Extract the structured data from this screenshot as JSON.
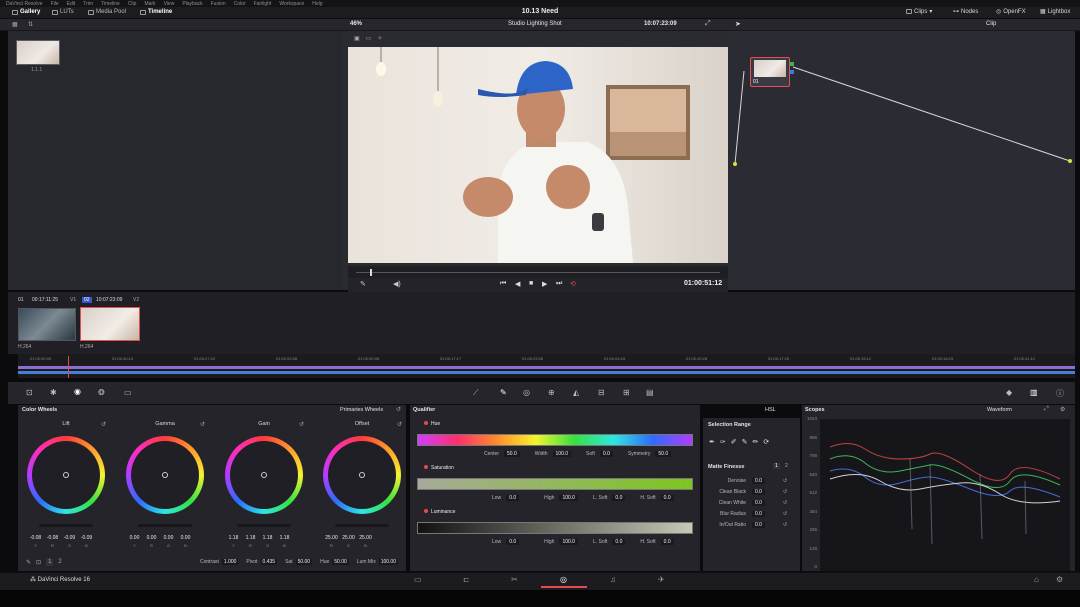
{
  "menubar": [
    "DaVinci Resolve",
    "File",
    "Edit",
    "Trim",
    "Timeline",
    "Clip",
    "Mark",
    "View",
    "Playback",
    "Fusion",
    "Color",
    "Fairlight",
    "Workspace",
    "Help"
  ],
  "topbar": {
    "tabs": [
      {
        "label": "Gallery"
      },
      {
        "label": "LUTs"
      },
      {
        "label": "Media Pool"
      },
      {
        "label": "Timeline"
      }
    ],
    "project_title": "10.13 Need",
    "right_tabs": [
      {
        "label": "Clips"
      },
      {
        "label": "Nodes"
      },
      {
        "label": "OpenFX"
      },
      {
        "label": "Lightbox"
      }
    ]
  },
  "viewer": {
    "zoom": "46%",
    "clip_name": "Studio Lighting Shot",
    "top_timecode": "10:07:23:09",
    "timecode": "01:00:51:12",
    "mode": "Clip"
  },
  "gallery": {
    "still_label": "1.1.1"
  },
  "node": {
    "label": "01"
  },
  "clips": {
    "header_track": "01",
    "header_tc1": "00:17:11:25",
    "header_track2": "02",
    "header_tc2": "10:07:23:09",
    "header_v": "V1",
    "header_v2": "V2",
    "items": [
      {
        "label": "H.264"
      },
      {
        "label": "H.264"
      }
    ]
  },
  "timeline": {
    "ticks": [
      "01:00:00:00",
      "01:00:40:13",
      "01:00:27:22",
      "01:00:53:08",
      "01:00:00:08",
      "01:00:17:17",
      "01:00:23:26",
      "01:00:04:15",
      "01:00:49:28",
      "01:00:17:25",
      "01:00:15:12",
      "01:00:18:23",
      "01:00:41:12"
    ]
  },
  "color_wheels": {
    "title": "Color Wheels",
    "mode": "Primaries Wheels",
    "wheels": [
      {
        "name": "Lift",
        "vals": [
          "-0.08",
          "-0.08",
          "-0.09",
          "-0.09"
        ],
        "sub": [
          "Y",
          "R",
          "G",
          "B"
        ]
      },
      {
        "name": "Gamma",
        "vals": [
          "0.00",
          "0.00",
          "0.00",
          "0.00"
        ],
        "sub": [
          "Y",
          "R",
          "G",
          "B"
        ]
      },
      {
        "name": "Gain",
        "vals": [
          "1.18",
          "1.18",
          "1.18",
          "1.18"
        ],
        "sub": [
          "Y",
          "R",
          "G",
          "B"
        ]
      },
      {
        "name": "Offset",
        "vals": [
          "25.00",
          "25.00",
          "25.00"
        ],
        "sub": [
          "R",
          "G",
          "B"
        ]
      }
    ],
    "adjust": [
      {
        "label": "Contrast",
        "val": "1.000"
      },
      {
        "label": "Pivot",
        "val": "0.435"
      },
      {
        "label": "Sat",
        "val": "50.00"
      },
      {
        "label": "Hue",
        "val": "50.00"
      },
      {
        "label": "Lum Mix",
        "val": "100.00"
      }
    ],
    "page_num_1": "1",
    "page_num_2": "2"
  },
  "qualifier": {
    "title": "Qualifier",
    "hue": {
      "label": "Hue",
      "center": "50.0",
      "width": "100.0",
      "soft": "0.0",
      "symmetry": "50.0"
    },
    "saturation": {
      "label": "Saturation",
      "low": "0.0",
      "high": "100.0",
      "lsoft": "0.0",
      "hsoft": "0.0"
    },
    "luminance": {
      "label": "Luminance",
      "low": "0.0",
      "high": "100.0",
      "lsoft": "0.0",
      "hsoft": "0.0"
    },
    "labels": {
      "center": "Center",
      "width": "Width",
      "soft": "Soft",
      "symmetry": "Symmetry",
      "low": "Low",
      "high": "High",
      "lsoft": "L. Soft",
      "hsoft": "H. Soft"
    },
    "hsl": "HSL"
  },
  "selection": {
    "title": "Selection Range",
    "matte_title": "Matte Finesse",
    "page1": "1",
    "page2": "2",
    "rows": [
      {
        "label": "Denoise",
        "val": "0.0"
      },
      {
        "label": "Clean Black",
        "val": "0.0"
      },
      {
        "label": "Clean White",
        "val": "0.0"
      },
      {
        "label": "Blur Radius",
        "val": "0.0"
      },
      {
        "label": "In/Out Ratio",
        "val": "0.0"
      }
    ]
  },
  "scopes": {
    "title": "Scopes",
    "mode": "Waveform",
    "yaxis": [
      "1023",
      "896",
      "768",
      "640",
      "512",
      "384",
      "256",
      "128",
      "0"
    ]
  },
  "app_name": "DaVinci Resolve 16",
  "colors": {
    "accent_red": "#e14b4b",
    "panel": "#24242a",
    "bg": "#0b0b0d"
  }
}
